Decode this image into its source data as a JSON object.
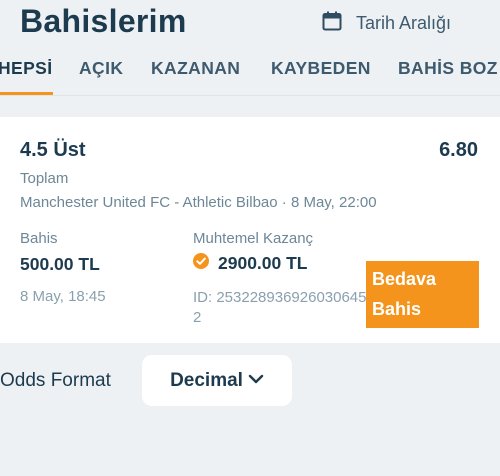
{
  "header": {
    "title": "Bahislerim",
    "date_range_label": "Tarih Aralığı"
  },
  "tabs": [
    {
      "label": "HEPSİ",
      "active": true
    },
    {
      "label": "AÇIK",
      "active": false
    },
    {
      "label": "KAZANAN",
      "active": false
    },
    {
      "label": "KAYBEDEN",
      "active": false
    },
    {
      "label": "BAHİS BOZ",
      "active": false
    }
  ],
  "bet": {
    "selection": "4.5 Üst",
    "odds": "6.80",
    "market": "Toplam",
    "event": "Manchester United FC - Athletic Bilbao · 8 May, 22:00",
    "stake_label": "Bahis",
    "stake_value": "500.00 TL",
    "placed_at": "8 May, 18:45",
    "potential_win_label": "Muhtemel Kazanç",
    "potential_win_value": "2900.00 TL",
    "bet_id": "ID: 2532289369260306452",
    "free_bet_badge": "Bedava Bahis"
  },
  "odds_format": {
    "label": "Odds Format",
    "selected": "Decimal"
  },
  "colors": {
    "accent": "#f5941d",
    "text_primary": "#1d3b4f",
    "background": "#eef1f4"
  },
  "icons": {
    "date": "calendar-icon",
    "win_status": "check-circle-icon",
    "dropdown": "chevron-down-icon"
  }
}
